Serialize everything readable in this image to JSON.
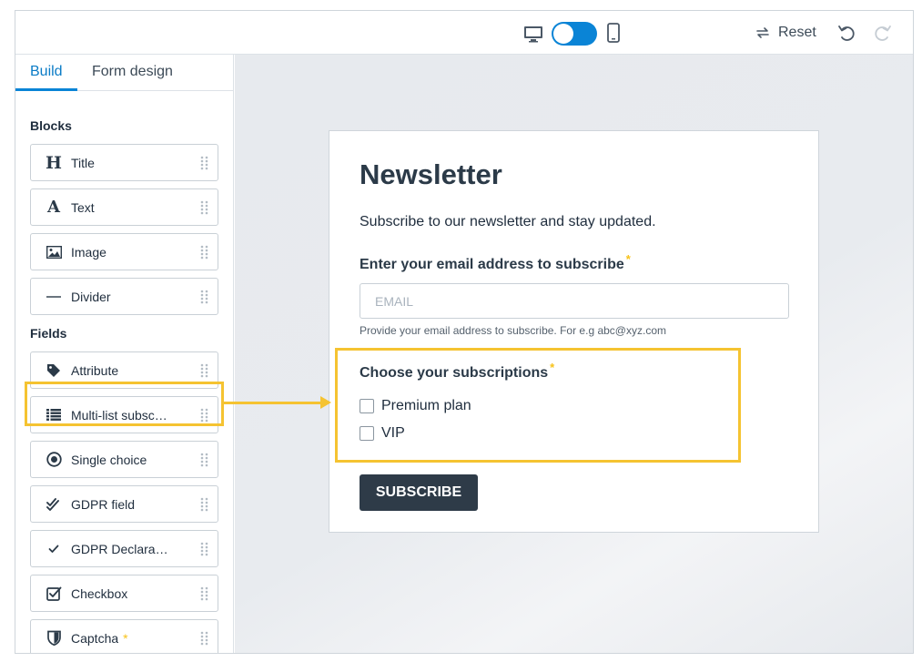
{
  "topbar": {
    "toggle_state": "mobile",
    "reset_label": "Reset",
    "icons": [
      "desktop-icon",
      "mobile-icon",
      "reset-icon",
      "undo-icon",
      "redo-icon"
    ]
  },
  "sidebar": {
    "tabs": [
      {
        "label": "Build",
        "active": true
      },
      {
        "label": "Form design",
        "active": false
      }
    ],
    "blocks_heading": "Blocks",
    "blocks": [
      {
        "label": "Title",
        "icon": "heading-icon"
      },
      {
        "label": "Text",
        "icon": "text-icon"
      },
      {
        "label": "Image",
        "icon": "image-icon"
      },
      {
        "label": "Divider",
        "icon": "divider-icon"
      }
    ],
    "fields_heading": "Fields",
    "fields": [
      {
        "label": "Attribute",
        "icon": "tag-icon"
      },
      {
        "label": "Multi-list subscription",
        "icon": "list-icon",
        "highlighted": true
      },
      {
        "label": "Single choice",
        "icon": "radio-icon"
      },
      {
        "label": "GDPR field",
        "icon": "double-check-icon"
      },
      {
        "label": "GDPR Declaration",
        "icon": "check-icon"
      },
      {
        "label": "Checkbox",
        "icon": "checkbox-icon"
      },
      {
        "label": "Captcha",
        "icon": "shield-icon",
        "star": "*"
      }
    ]
  },
  "form": {
    "title": "Newsletter",
    "subtitle": "Subscribe to our newsletter and stay updated.",
    "email_label": "Enter your email address to subscribe",
    "required_mark": "*",
    "email_placeholder": "EMAIL",
    "email_help": "Provide your email address to subscribe. For e.g abc@xyz.com",
    "subscriptions_label": "Choose your subscriptions",
    "options": [
      "Premium plan",
      "VIP"
    ],
    "submit_label": "SUBSCRIBE"
  },
  "colors": {
    "accent": "#0a84d6",
    "highlight": "#f5c331",
    "button": "#2e3b48",
    "required": "#f7c21a"
  }
}
